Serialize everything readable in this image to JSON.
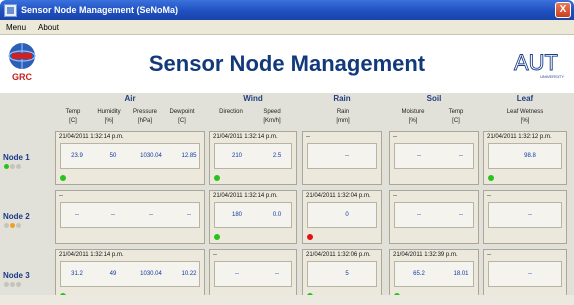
{
  "window": {
    "title": "Sensor Node Management (SeNoMa)",
    "close": "X"
  },
  "menu": [
    "Menu",
    "About"
  ],
  "header": {
    "title": "Sensor Node Management",
    "left_logo": "GRC",
    "right_logo": "AUT",
    "right_logo_sub": "UNIVERSITY"
  },
  "groups": [
    "Air",
    "Wind",
    "Rain",
    "Soil",
    "Leaf"
  ],
  "columns": {
    "temp": [
      "Temp",
      "[C]"
    ],
    "humidity": [
      "Humidity",
      "[%]"
    ],
    "pressure": [
      "Pressure",
      "[hPa]"
    ],
    "dewpoint": [
      "Dewpoint",
      "[C]"
    ],
    "direction": [
      "Direction",
      ""
    ],
    "speed": [
      "Speed",
      "[Km/h]"
    ],
    "rain": [
      "Rain",
      "[mm]"
    ],
    "moisture": [
      "Moisture",
      "[%]"
    ],
    "soiltemp": [
      "Temp",
      "[C]"
    ],
    "leaf": [
      "Leaf Wetness",
      "[%]"
    ]
  },
  "nodes": [
    {
      "name": "Node 1",
      "air": {
        "ts": "21/04/2011 1:32:14 p.m.",
        "values": [
          "23.9",
          "50",
          "1030.04",
          "12.85"
        ]
      },
      "wind": {
        "ts": "21/04/2011 1:32:14 p.m.",
        "values": [
          "210",
          "2.5"
        ]
      },
      "rain": {
        "ts": "--",
        "values": [
          "--"
        ]
      },
      "soil": {
        "ts": "--",
        "values": [
          "--",
          "--"
        ]
      },
      "leaf": {
        "ts": "21/04/2011 1:32:12 p.m.",
        "values": [
          "98.8"
        ]
      }
    },
    {
      "name": "Node 2",
      "air": {
        "ts": "--",
        "values": [
          "--",
          "--",
          "--",
          "--"
        ]
      },
      "wind": {
        "ts": "21/04/2011 1:32:14 p.m.",
        "values": [
          "180",
          "0.0"
        ]
      },
      "rain": {
        "ts": "21/04/2011 1:32:04 p.m.",
        "values": [
          "0"
        ]
      },
      "soil": {
        "ts": "--",
        "values": [
          "--",
          "--"
        ]
      },
      "leaf": {
        "ts": "--",
        "values": [
          "--"
        ]
      }
    },
    {
      "name": "Node 3",
      "air": {
        "ts": "21/04/2011 1:32:14 p.m.",
        "values": [
          "31.2",
          "49",
          "1030.04",
          "10.22"
        ]
      },
      "wind": {
        "ts": "--",
        "values": [
          "--",
          "--"
        ]
      },
      "rain": {
        "ts": "21/04/2011 1:32:06 p.m.",
        "values": [
          "5"
        ]
      },
      "soil": {
        "ts": "21/04/2011 1:32:39 p.m.",
        "values": [
          "65.2",
          "18.01"
        ]
      },
      "leaf": {
        "ts": "--",
        "values": [
          "--"
        ]
      }
    }
  ],
  "colors": {
    "value_text": "#0d3aa8",
    "title_text": "#123a7a",
    "led_green": "#29c21f",
    "led_red": "#e01414",
    "led_orange": "#f0a020",
    "led_off": "#c4c4bc"
  },
  "node_dots": [
    [
      "led_green",
      "led_off",
      "led_off"
    ],
    [
      "led_off",
      "led_orange",
      "led_off"
    ],
    [
      "led_off",
      "led_off",
      "led_off"
    ]
  ],
  "panel_leds": {
    "0": {
      "air": "led_green",
      "wind": "led_green",
      "leaf": "led_green"
    },
    "1": {
      "wind": "led_green",
      "rain": "led_red"
    },
    "2": {
      "air": "led_green",
      "rain": "led_green",
      "soil": "led_green"
    }
  },
  "icons": {
    "app": "window-app-icon",
    "close": "close-icon",
    "grc": "grc-globe-logo",
    "aut": "aut-university-logo"
  }
}
